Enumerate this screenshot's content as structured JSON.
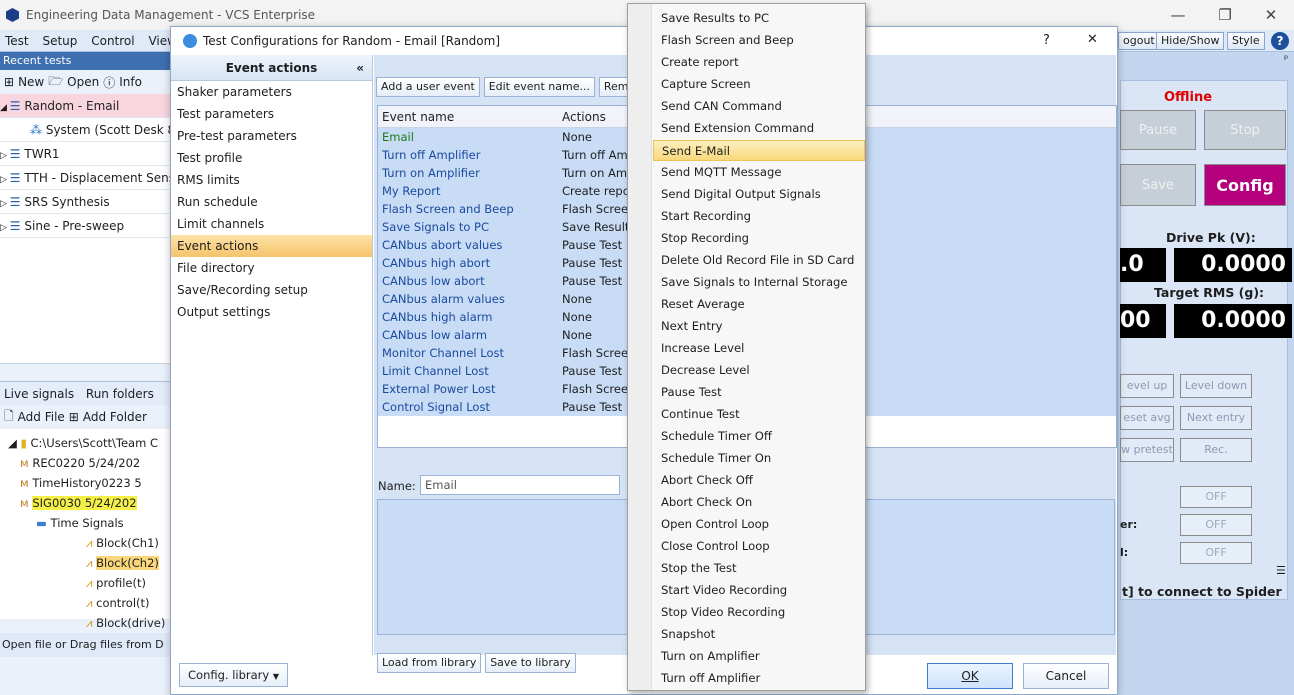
{
  "window": {
    "title": "Engineering Data Management - VCS Enterprise",
    "min_icon": "minimize-icon",
    "max_icon": "restore-icon",
    "close_icon": "close-icon"
  },
  "menubar": {
    "items": [
      "Test",
      "Setup",
      "Control",
      "View"
    ]
  },
  "ribbon_right": {
    "logout": "ogout",
    "hideshow": "Hide/Show",
    "style": "Style",
    "help": "?"
  },
  "left_panel": {
    "header": "Recent tests",
    "toolbar": {
      "new": "New",
      "open": "Open",
      "info": "Info"
    },
    "tests": [
      {
        "label": "Random - Email"
      },
      {
        "label": "System (Scott Desk 8C"
      },
      {
        "label": "TWR1"
      },
      {
        "label": "TTH - Displacement Sens"
      },
      {
        "label": "SRS Synthesis"
      },
      {
        "label": "Sine - Pre-sweep"
      }
    ],
    "tabs": {
      "live": "Live signals",
      "runs": "Run folders"
    },
    "file_toolbar": {
      "add_file": "Add File",
      "add_folder": "Add Folder"
    },
    "files": [
      {
        "label": "C:\\Users\\Scott\\Team C"
      },
      {
        "label": "REC0220 5/24/202"
      },
      {
        "label": "TimeHistory0223 5"
      },
      {
        "label": "SIG0030 5/24/202"
      },
      {
        "label": "Time Signals"
      },
      {
        "label": "Block(Ch1)"
      },
      {
        "label": "Block(Ch2)"
      },
      {
        "label": "profile(t)"
      },
      {
        "label": "control(t)"
      },
      {
        "label": "Block(drive)"
      },
      {
        "label": "Frequency Signa"
      }
    ],
    "status": "Open file or Drag files from D"
  },
  "dialog": {
    "title": "Test Configurations for Random - Email [Random]",
    "help": "?",
    "close": "✕",
    "nav_header": "Event actions",
    "nav_collapse": "«",
    "nav_items": [
      "Shaker parameters",
      "Test parameters",
      "Pre-test parameters",
      "Test profile",
      "RMS limits",
      "Run schedule",
      "Limit channels",
      "Event actions",
      "File directory",
      "Save/Recording setup",
      "Output settings"
    ],
    "toolbar": {
      "add": "Add a user event",
      "edit": "Edit event name...",
      "remove": "Remove"
    },
    "grid_headers": {
      "name": "Event name",
      "actions": "Actions"
    },
    "events": [
      {
        "name": "Email",
        "action": "None"
      },
      {
        "name": "Turn off Amplifier",
        "action": "Turn off Amp"
      },
      {
        "name": "Turn on Amplifier",
        "action": "Turn on Amp"
      },
      {
        "name": "My Report",
        "action": "Create report"
      },
      {
        "name": "Flash Screen and Beep",
        "action": "Flash Screen"
      },
      {
        "name": "Save Signals to PC",
        "action": "Save Results"
      },
      {
        "name": "CANbus abort values",
        "action": "Pause Test"
      },
      {
        "name": "CANbus high abort",
        "action": "Pause Test"
      },
      {
        "name": "CANbus low abort",
        "action": "Pause Test"
      },
      {
        "name": "CANbus alarm values",
        "action": "None"
      },
      {
        "name": "CANbus high alarm",
        "action": "None"
      },
      {
        "name": "CANbus low alarm",
        "action": "None"
      },
      {
        "name": "Monitor Channel Lost",
        "action": "Flash Screen"
      },
      {
        "name": "Limit Channel Lost",
        "action": "Pause Test"
      },
      {
        "name": "External Power Lost",
        "action": "Flash Screen"
      },
      {
        "name": "Control Signal Lost",
        "action": "Pause Test"
      }
    ],
    "name_label": "Name:",
    "name_value": "Email",
    "load_lib": "Load from library",
    "save_lib": "Save to library",
    "config_lib": "Config. library",
    "ok": "OK",
    "cancel": "Cancel"
  },
  "context_menu": {
    "highlighted": "Send E-Mail",
    "items": [
      "Save Results to PC",
      "Flash Screen and Beep",
      "Create report",
      "Capture Screen",
      "Send CAN Command",
      "Send Extension Command",
      "Send E-Mail",
      "Send MQTT Message",
      "Send Digital Output Signals",
      "Start Recording",
      "Stop Recording",
      "Delete Old Record File in SD Card",
      "Save Signals to Internal Storage",
      "Reset Average",
      "Next Entry",
      "Increase Level",
      "Decrease Level",
      "Pause Test",
      "Continue Test",
      "Schedule Timer Off",
      "Schedule Timer On",
      "Abort Check Off",
      "Abort Check On",
      "Open Control Loop",
      "Close Control Loop",
      "Stop the Test",
      "Start Video Recording",
      "Stop Video Recording",
      "Snapshot",
      "Turn on Amplifier",
      "Turn off Amplifier"
    ]
  },
  "right_panel": {
    "pin": "ᵖ",
    "status": "Offline",
    "pause": "Pause",
    "stop": "Stop",
    "save": "Save",
    "config": "Config",
    "drive_label": "Drive Pk (V):",
    "drive_left": ".0",
    "drive_value": "0.0000",
    "target_label": "Target RMS (g):",
    "target_left": "00",
    "target_value": "0.0000",
    "level_up": "evel up",
    "level_down": "Level down",
    "reset_avg": "eset avg",
    "next_entry": "Next entry",
    "pretest": "w pretest",
    "rec": "Rec.",
    "off1": "OFF",
    "off2": "OFF",
    "off3": "OFF",
    "lbl_er": "er:",
    "lbl_l": "l:",
    "connect": "t] to connect to Spider",
    "colors": {
      "status": "#e00000",
      "config_bg": "#b5007e"
    }
  }
}
